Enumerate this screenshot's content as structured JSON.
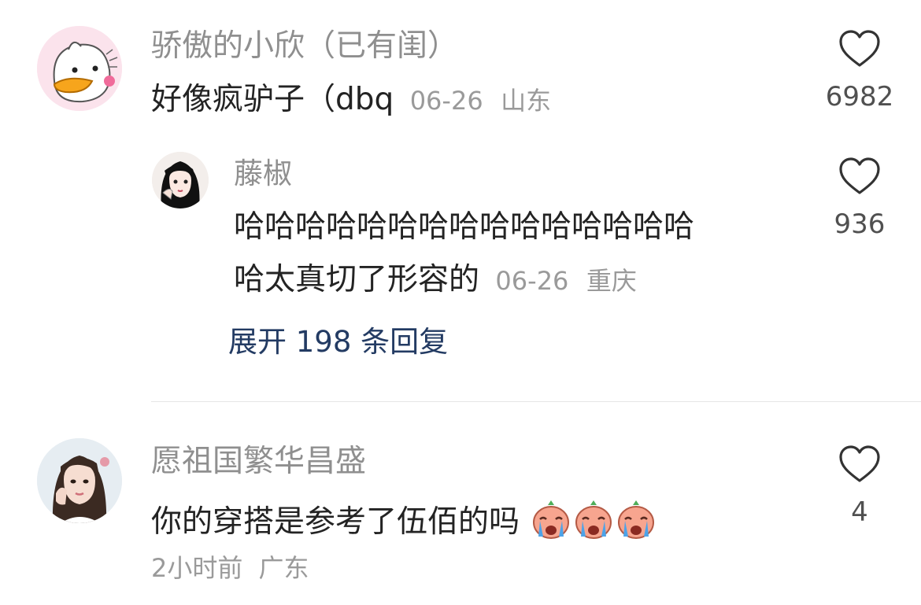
{
  "comments": [
    {
      "username": "骄傲的小欣（已有闺）",
      "text": "好像疯驴子（dbq",
      "date": "06-26",
      "location": "山东",
      "like_count": "6982",
      "avatar_icon": "duck-avatar-icon",
      "reply": {
        "username": "藤椒",
        "text_line1": "哈哈哈哈哈哈哈哈哈哈哈哈哈哈哈",
        "text_line2": "哈太真切了形容的",
        "date": "06-26",
        "location": "重庆",
        "like_count": "936",
        "avatar_icon": "anime-girl-avatar-icon"
      },
      "expand_label": "展开 198 条回复"
    },
    {
      "username": "愿祖国繁华昌盛",
      "text": "你的穿搭是参考了伍佰的吗",
      "emoji_icons": [
        "crying-emoji-icon",
        "crying-emoji-icon",
        "crying-emoji-icon"
      ],
      "time": "2小时前",
      "location": "广东",
      "like_count": "4",
      "avatar_icon": "girl-photo-avatar-icon"
    }
  ],
  "colors": {
    "username": "#8f8f8f",
    "text": "#232323",
    "meta": "#9a9a9a",
    "expand_link": "#233b63",
    "heart_stroke": "#333333"
  }
}
